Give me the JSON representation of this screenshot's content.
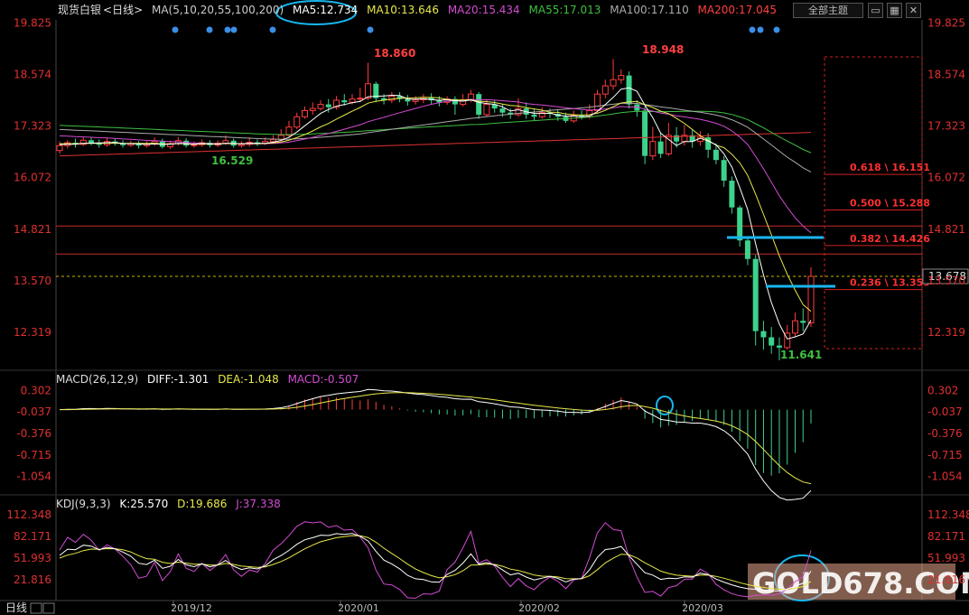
{
  "header": {
    "instrument": "现货白银",
    "period": "<日线>",
    "ma_label": "MA(5,10,20,55,100,200)",
    "ma5": "MA5:12.734",
    "ma10": "MA10:13.646",
    "ma20": "MA20:15.434",
    "ma55": "MA55:17.013",
    "ma100": "MA100:17.110",
    "ma200": "MA200:17.045",
    "theme_button": "全部主题"
  },
  "price_panel": {
    "y_ticks": [
      "19.825",
      "18.574",
      "17.323",
      "16.072",
      "14.821",
      "13.570",
      "12.319"
    ],
    "current_price": "13.678",
    "annotations": {
      "high1": "18.860",
      "high2": "18.948",
      "low1": "16.529",
      "low2": "11.641"
    },
    "fib_levels": [
      {
        "label": "0.618 \\ 16.151",
        "value": 16.151
      },
      {
        "label": "0.500 \\ 15.288",
        "value": 15.288
      },
      {
        "label": "0.382 \\ 14.426",
        "value": 14.426
      },
      {
        "label": "0.236 \\ 13.359",
        "value": 13.359
      }
    ]
  },
  "macd_panel": {
    "title": "MACD(26,12,9)",
    "diff": "DIFF:-1.301",
    "dea": "DEA:-1.048",
    "macd": "MACD:-0.507",
    "y_ticks": [
      "0.302",
      "-0.037",
      "-0.376",
      "-0.715",
      "-1.054"
    ]
  },
  "kdj_panel": {
    "title": "KDJ(9,3,3)",
    "k": "K:25.570",
    "d": "D:19.686",
    "j": "J:37.338",
    "y_ticks": [
      "112.348",
      "82.171",
      "51.993",
      "21.816"
    ]
  },
  "x_axis": {
    "period_label": "日线",
    "months": [
      "2019/12",
      "2020/01",
      "2020/02",
      "2020/03"
    ]
  },
  "watermark": "GOLD678.COM",
  "chart_data": {
    "type": "candlestick",
    "price_range": [
      11.4,
      19.9
    ],
    "candles_count": 96,
    "candles": [
      [
        16.73,
        16.85,
        16.95,
        16.65
      ],
      [
        16.85,
        16.92,
        16.98,
        16.78
      ],
      [
        16.92,
        16.88,
        17.02,
        16.8
      ],
      [
        16.88,
        16.98,
        17.05,
        16.84
      ],
      [
        16.98,
        16.92,
        17.06,
        16.86
      ],
      [
        16.92,
        16.87,
        17.0,
        16.8
      ],
      [
        16.87,
        16.95,
        17.03,
        16.82
      ],
      [
        16.95,
        16.9,
        17.02,
        16.85
      ],
      [
        16.9,
        16.86,
        16.98,
        16.8
      ],
      [
        16.86,
        16.9,
        16.97,
        16.82
      ],
      [
        16.9,
        16.85,
        16.96,
        16.78
      ],
      [
        16.85,
        16.89,
        16.96,
        16.8
      ],
      [
        16.89,
        16.95,
        17.05,
        16.84
      ],
      [
        16.95,
        16.82,
        17.02,
        16.78
      ],
      [
        16.82,
        16.9,
        16.97,
        16.77
      ],
      [
        16.9,
        16.97,
        17.06,
        16.85
      ],
      [
        16.97,
        16.85,
        17.03,
        16.8
      ],
      [
        16.85,
        16.87,
        16.95,
        16.8
      ],
      [
        16.87,
        16.92,
        17.0,
        16.82
      ],
      [
        16.92,
        16.86,
        16.98,
        16.8
      ],
      [
        16.86,
        16.91,
        16.98,
        16.82
      ],
      [
        16.91,
        16.97,
        17.1,
        16.87
      ],
      [
        16.97,
        16.85,
        17.02,
        16.8
      ],
      [
        16.85,
        16.88,
        16.96,
        16.8
      ],
      [
        16.88,
        16.93,
        17.05,
        16.82
      ],
      [
        16.93,
        16.9,
        17.0,
        16.84
      ],
      [
        16.9,
        16.95,
        17.05,
        16.86
      ],
      [
        16.95,
        17.0,
        17.1,
        16.9
      ],
      [
        17.0,
        17.1,
        17.25,
        16.95
      ],
      [
        17.1,
        17.3,
        17.45,
        17.05
      ],
      [
        17.3,
        17.55,
        17.65,
        17.25
      ],
      [
        17.55,
        17.7,
        17.8,
        17.5
      ],
      [
        17.7,
        17.75,
        17.9,
        17.6
      ],
      [
        17.75,
        17.85,
        17.95,
        17.7
      ],
      [
        17.85,
        17.78,
        17.98,
        17.65
      ],
      [
        17.78,
        17.95,
        18.05,
        17.72
      ],
      [
        17.95,
        17.9,
        18.1,
        17.82
      ],
      [
        17.9,
        17.98,
        18.1,
        17.85
      ],
      [
        17.98,
        18.0,
        18.25,
        17.9
      ],
      [
        18.0,
        18.35,
        18.86,
        17.95
      ],
      [
        18.35,
        18.0,
        18.4,
        17.9
      ],
      [
        18.0,
        17.95,
        18.1,
        17.85
      ],
      [
        17.95,
        18.05,
        18.15,
        17.88
      ],
      [
        18.05,
        17.98,
        18.15,
        17.9
      ],
      [
        17.98,
        17.92,
        18.08,
        17.82
      ],
      [
        17.92,
        17.96,
        18.05,
        17.85
      ],
      [
        17.96,
        18.02,
        18.1,
        17.88
      ],
      [
        18.02,
        17.95,
        18.12,
        17.85
      ],
      [
        17.95,
        17.9,
        18.05,
        17.8
      ],
      [
        17.9,
        17.98,
        18.05,
        17.84
      ],
      [
        17.98,
        17.85,
        18.05,
        17.6
      ],
      [
        17.85,
        17.96,
        18.1,
        17.8
      ],
      [
        17.96,
        18.1,
        18.2,
        17.9
      ],
      [
        18.1,
        17.6,
        18.15,
        17.5
      ],
      [
        17.6,
        17.85,
        17.95,
        17.55
      ],
      [
        17.85,
        17.75,
        17.95,
        17.65
      ],
      [
        17.75,
        17.65,
        17.85,
        17.55
      ],
      [
        17.65,
        17.6,
        17.75,
        17.5
      ],
      [
        17.6,
        17.75,
        18.0,
        17.55
      ],
      [
        17.75,
        17.6,
        17.9,
        17.5
      ],
      [
        17.6,
        17.55,
        17.75,
        17.45
      ],
      [
        17.55,
        17.65,
        17.78,
        17.5
      ],
      [
        17.65,
        17.62,
        17.75,
        17.52
      ],
      [
        17.62,
        17.55,
        17.72,
        17.45
      ],
      [
        17.55,
        17.45,
        17.65,
        17.4
      ],
      [
        17.45,
        17.58,
        17.7,
        17.4
      ],
      [
        17.58,
        17.55,
        17.7,
        17.48
      ],
      [
        17.55,
        17.7,
        17.85,
        17.5
      ],
      [
        17.7,
        18.1,
        18.2,
        17.65
      ],
      [
        18.1,
        18.3,
        18.45,
        18.0
      ],
      [
        18.3,
        18.45,
        18.95,
        18.2
      ],
      [
        18.45,
        18.55,
        18.7,
        18.35
      ],
      [
        18.55,
        17.85,
        18.65,
        17.75
      ],
      [
        17.85,
        17.7,
        17.95,
        17.55
      ],
      [
        17.7,
        16.6,
        17.8,
        16.4
      ],
      [
        16.6,
        16.95,
        17.3,
        16.5
      ],
      [
        16.95,
        16.65,
        17.15,
        16.55
      ],
      [
        16.65,
        17.1,
        17.4,
        16.6
      ],
      [
        17.1,
        16.95,
        17.3,
        16.8
      ],
      [
        16.95,
        17.1,
        17.35,
        16.85
      ],
      [
        17.1,
        16.95,
        17.25,
        16.8
      ],
      [
        16.95,
        17.05,
        17.2,
        16.85
      ],
      [
        17.05,
        16.75,
        17.15,
        16.55
      ],
      [
        16.75,
        16.5,
        16.9,
        16.4
      ],
      [
        16.5,
        16.0,
        16.6,
        15.85
      ],
      [
        16.0,
        15.35,
        16.1,
        15.2
      ],
      [
        15.35,
        14.55,
        15.4,
        14.4
      ],
      [
        14.55,
        14.1,
        14.65,
        13.95
      ],
      [
        14.1,
        12.35,
        14.2,
        12.0
      ],
      [
        12.35,
        12.2,
        12.6,
        11.9
      ],
      [
        12.2,
        12.0,
        12.45,
        11.8
      ],
      [
        12.0,
        11.95,
        12.2,
        11.641
      ],
      [
        11.95,
        12.3,
        12.5,
        11.9
      ],
      [
        12.3,
        12.6,
        12.8,
        12.2
      ],
      [
        12.6,
        12.55,
        12.9,
        12.35
      ],
      [
        12.55,
        13.678,
        13.9,
        12.45
      ]
    ],
    "macd": {
      "range": [
        -1.3,
        0.45
      ]
    },
    "kdj": {
      "range": [
        -5,
        125
      ]
    }
  }
}
